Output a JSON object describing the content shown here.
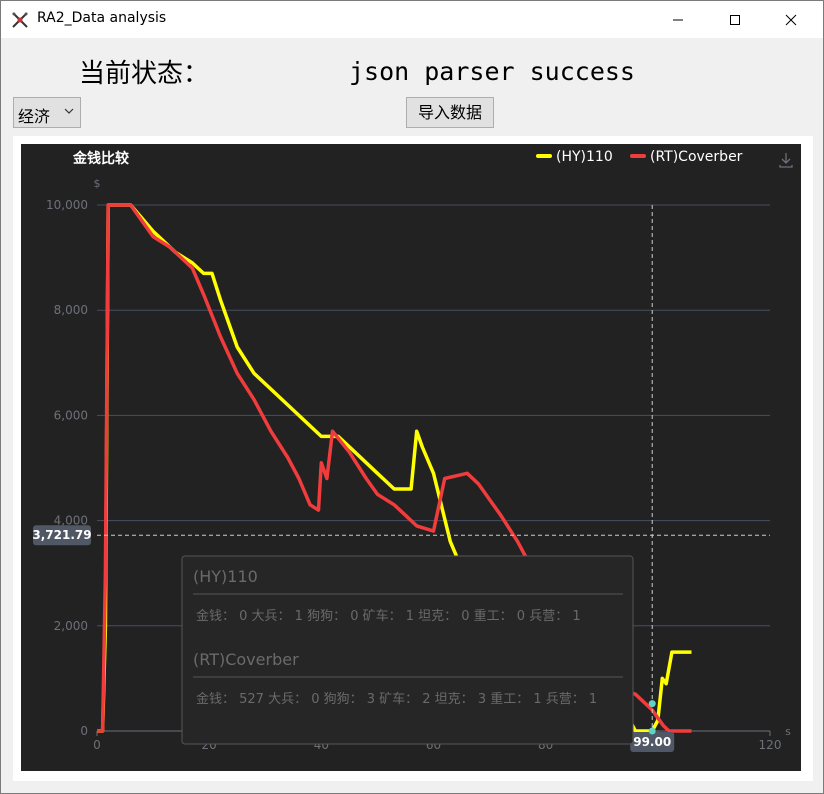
{
  "window": {
    "title": "RA2_Data analysis",
    "icon": "ra2-logo-icon",
    "controls": [
      "minimize-icon",
      "maximize-icon",
      "close-icon"
    ]
  },
  "status": {
    "label": "当前状态：",
    "value": "json parser success"
  },
  "mode_select": {
    "selected": "经济"
  },
  "import_button": {
    "label": "导入数据"
  },
  "colors": {
    "series_hy": "#ffff00",
    "series_rt": "#f03c3c",
    "chart_bg": "#222222",
    "axis_text": "#6e7079",
    "tooltip_bg": "#262626"
  },
  "chart_data": {
    "type": "line",
    "title": "金钱比较",
    "ylabel": "$",
    "xlabel": "s",
    "xlim": [
      0,
      120
    ],
    "ylim": [
      0,
      10000
    ],
    "xticks": [
      0,
      20,
      40,
      60,
      80,
      100,
      120
    ],
    "yticks": [
      "0",
      "2,000",
      "4,000",
      "6,000",
      "8,000",
      "10,000"
    ],
    "legend_position": "top-right",
    "grid": true,
    "series": [
      {
        "name": "(HY)110",
        "color": "#ffff00",
        "points": [
          [
            0,
            0
          ],
          [
            1,
            0
          ],
          [
            1.5,
            2000
          ],
          [
            2,
            10000
          ],
          [
            6,
            10000
          ],
          [
            10,
            9500
          ],
          [
            14,
            9100
          ],
          [
            17,
            8900
          ],
          [
            19,
            8700
          ],
          [
            20.5,
            8700
          ],
          [
            22,
            8200
          ],
          [
            25,
            7300
          ],
          [
            28,
            6800
          ],
          [
            32,
            6400
          ],
          [
            36,
            6000
          ],
          [
            40,
            5600
          ],
          [
            43,
            5600
          ],
          [
            46,
            5300
          ],
          [
            50,
            4900
          ],
          [
            53,
            4600
          ],
          [
            56,
            4600
          ],
          [
            57,
            5700
          ],
          [
            58,
            5400
          ],
          [
            60,
            4900
          ],
          [
            63,
            3600
          ],
          [
            65,
            3100
          ],
          [
            66,
            3000
          ],
          [
            75,
            2500
          ],
          [
            85,
            1500
          ],
          [
            90,
            900
          ],
          [
            95,
            200
          ],
          [
            96,
            0
          ],
          [
            99,
            0
          ],
          [
            100,
            200
          ],
          [
            100.8,
            1000
          ],
          [
            101.5,
            900
          ],
          [
            102.5,
            1500
          ],
          [
            106,
            1500
          ]
        ]
      },
      {
        "name": "(RT)Coverber",
        "color": "#f03c3c",
        "points": [
          [
            0,
            0
          ],
          [
            1,
            0
          ],
          [
            1.5,
            3000
          ],
          [
            2,
            10000
          ],
          [
            6,
            10000
          ],
          [
            10,
            9400
          ],
          [
            13,
            9200
          ],
          [
            15,
            9000
          ],
          [
            17,
            8800
          ],
          [
            19,
            8300
          ],
          [
            22,
            7500
          ],
          [
            25,
            6800
          ],
          [
            28,
            6300
          ],
          [
            31,
            5700
          ],
          [
            34,
            5200
          ],
          [
            36,
            4800
          ],
          [
            38,
            4300
          ],
          [
            39.5,
            4200
          ],
          [
            40,
            5100
          ],
          [
            41,
            4800
          ],
          [
            42,
            5700
          ],
          [
            45,
            5300
          ],
          [
            48,
            4800
          ],
          [
            50,
            4500
          ],
          [
            53,
            4300
          ],
          [
            55,
            4100
          ],
          [
            57,
            3900
          ],
          [
            60,
            3800
          ],
          [
            62,
            4800
          ],
          [
            66,
            4900
          ],
          [
            68,
            4700
          ],
          [
            70,
            4400
          ],
          [
            72,
            4100
          ],
          [
            75,
            3600
          ],
          [
            78,
            3000
          ],
          [
            82,
            2200
          ],
          [
            86,
            1500
          ],
          [
            90,
            1000
          ],
          [
            93,
            800
          ],
          [
            96,
            700
          ],
          [
            98,
            500
          ],
          [
            99,
            400
          ],
          [
            101,
            100
          ],
          [
            102,
            0
          ],
          [
            106,
            0
          ]
        ]
      }
    ],
    "axis_pointer": {
      "x_label": "99.00",
      "y_label": "3,721.79",
      "x": 99,
      "y": 3721.79
    },
    "tooltip": {
      "entries": [
        {
          "name": "(HY)110",
          "detail": "金钱：  0 大兵：  1 狗狗：  0 矿车：  1 坦克：  0 重工：  0 兵营：  1"
        },
        {
          "name": "(RT)Coverber",
          "detail": "金钱：  527 大兵：  0 狗狗：  3 矿车：  2 坦克：  3 重工：  1 兵营：  1"
        }
      ]
    }
  }
}
